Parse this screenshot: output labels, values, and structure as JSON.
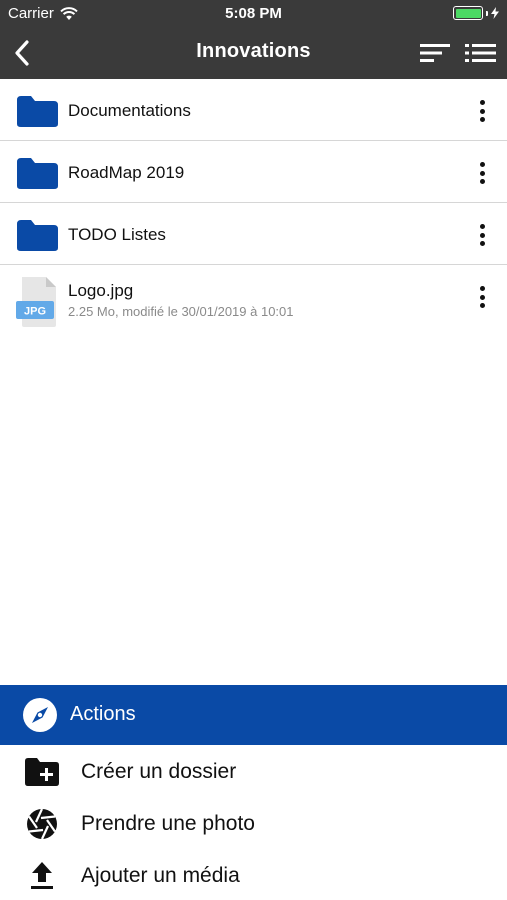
{
  "status_bar": {
    "carrier": "Carrier",
    "time": "5:08 PM",
    "battery_level": 1.0,
    "battery_color": "#4cd964"
  },
  "nav": {
    "title": "Innovations",
    "back_icon": "chevron-left-icon",
    "sort_icon": "sort-icon",
    "list_icon": "list-view-icon",
    "background": "#3a3a3a"
  },
  "files": {
    "folders": [
      {
        "name": "Documentations",
        "icon": "folder-icon"
      },
      {
        "name": "RoadMap 2019",
        "icon": "folder-icon"
      },
      {
        "name": "TODO Listes",
        "icon": "folder-icon"
      }
    ],
    "file": {
      "name": "Logo.jpg",
      "meta": "2.25 Mo, modifié le 30/01/2019 à 10:01",
      "badge": "JPG",
      "icon": "jpg-file-icon"
    },
    "folder_color": "#0a4aa6"
  },
  "actions": {
    "title": "Actions",
    "header_color": "#0a4aa6",
    "items": [
      {
        "label": "Créer un dossier",
        "icon": "create-folder-icon"
      },
      {
        "label": "Prendre une photo",
        "icon": "camera-shutter-icon"
      },
      {
        "label": "Ajouter un média",
        "icon": "upload-icon"
      }
    ]
  }
}
